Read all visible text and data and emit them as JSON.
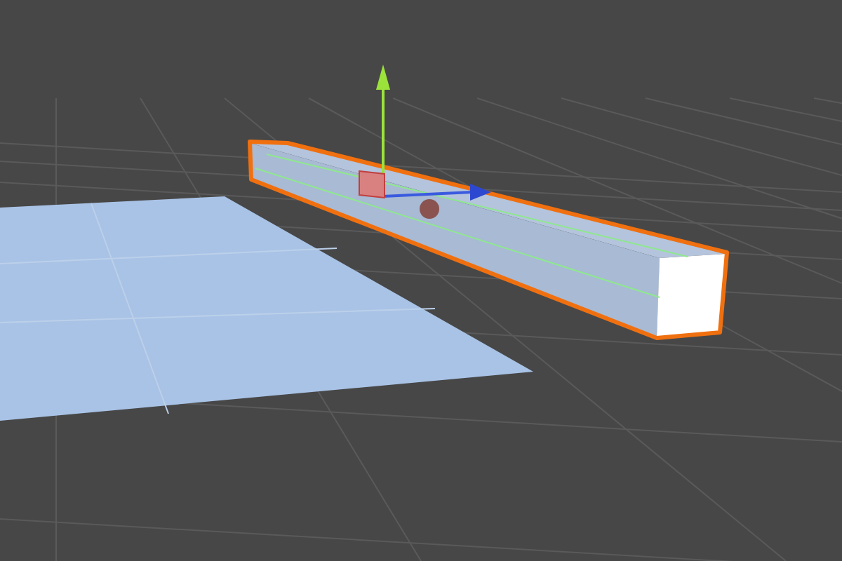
{
  "scene": {
    "objects": [
      {
        "kind": "plane",
        "selected": false
      },
      {
        "kind": "box",
        "selected": true
      }
    ],
    "gizmo": {
      "kind": "move"
    }
  }
}
